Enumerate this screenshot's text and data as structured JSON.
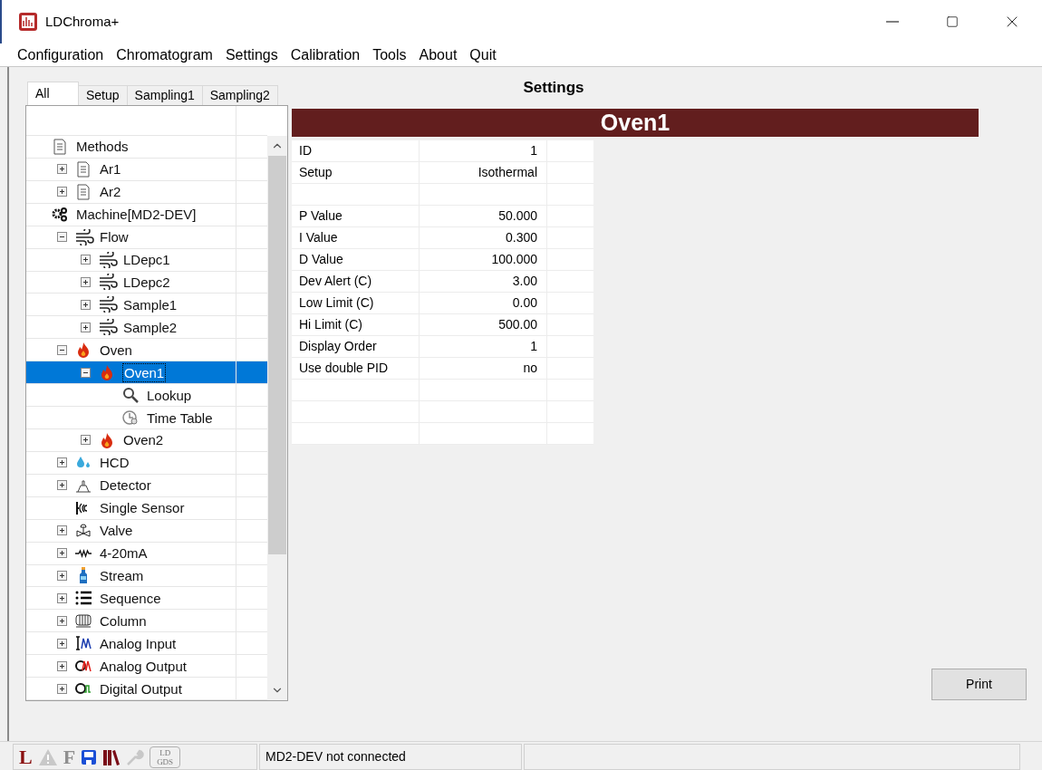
{
  "window": {
    "title": "LDChroma+"
  },
  "menu": [
    "Configuration",
    "Chromatogram",
    "Settings",
    "Calibration",
    "Tools",
    "About",
    "Quit"
  ],
  "tabs": [
    {
      "label": "All",
      "selected": true
    },
    {
      "label": "Setup",
      "selected": false
    },
    {
      "label": "Sampling1",
      "selected": false
    },
    {
      "label": "Sampling2",
      "selected": false
    }
  ],
  "tree": [
    {
      "label": "Methods",
      "kind": "document",
      "selected": false,
      "children": [
        {
          "label": "Ar1",
          "kind": "document",
          "expanded": false,
          "selected": false
        },
        {
          "label": "Ar2",
          "kind": "document",
          "expanded": false,
          "selected": false
        }
      ]
    },
    {
      "label": "Machine[MD2-DEV]",
      "kind": "gears",
      "selected": false,
      "children": [
        {
          "label": "Flow",
          "kind": "flow",
          "expanded": true,
          "selected": false,
          "children": [
            {
              "label": "LDepc1",
              "kind": "flow",
              "expanded": false,
              "selected": false
            },
            {
              "label": "LDepc2",
              "kind": "flow",
              "expanded": false,
              "selected": false
            },
            {
              "label": "Sample1",
              "kind": "flow",
              "expanded": false,
              "selected": false
            },
            {
              "label": "Sample2",
              "kind": "flow",
              "expanded": false,
              "selected": false
            }
          ]
        },
        {
          "label": "Oven",
          "kind": "flame",
          "expanded": true,
          "selected": false,
          "children": [
            {
              "label": "Oven1",
              "kind": "flame",
              "expanded": true,
              "selected": true,
              "children": [
                {
                  "label": "Lookup",
                  "kind": "search",
                  "selected": false
                },
                {
                  "label": "Time Table",
                  "kind": "clock",
                  "selected": false
                }
              ]
            },
            {
              "label": "Oven2",
              "kind": "flame",
              "expanded": false,
              "selected": false
            }
          ]
        },
        {
          "label": "HCD",
          "kind": "drops",
          "expanded": false,
          "selected": false
        },
        {
          "label": "Detector",
          "kind": "detector",
          "expanded": false,
          "selected": false
        },
        {
          "label": "Single Sensor",
          "kind": "sensor",
          "selected": false
        },
        {
          "label": "Valve",
          "kind": "valve",
          "expanded": false,
          "selected": false
        },
        {
          "label": "4-20mA",
          "kind": "resistor",
          "expanded": false,
          "selected": false
        },
        {
          "label": "Stream",
          "kind": "bottle",
          "expanded": false,
          "selected": false
        },
        {
          "label": "Sequence",
          "kind": "list",
          "expanded": false,
          "selected": false
        },
        {
          "label": "Column",
          "kind": "column",
          "expanded": false,
          "selected": false
        },
        {
          "label": "Analog Input",
          "kind": "analog-in",
          "expanded": false,
          "selected": false
        },
        {
          "label": "Analog Output",
          "kind": "analog-out",
          "expanded": false,
          "selected": false
        },
        {
          "label": "Digital Output",
          "kind": "digital-out",
          "expanded": false,
          "selected": false
        }
      ]
    }
  ],
  "settings": {
    "title": "Settings",
    "banner": "Oven1",
    "rows": [
      {
        "kind": "field",
        "label": "ID",
        "value": "1"
      },
      {
        "kind": "field",
        "label": "Setup",
        "value": "Isothermal"
      },
      {
        "kind": "blank"
      },
      {
        "kind": "field",
        "label": "P Value",
        "value": "50.000"
      },
      {
        "kind": "field",
        "label": "I Value",
        "value": "0.300"
      },
      {
        "kind": "field",
        "label": "D Value",
        "value": "100.000"
      },
      {
        "kind": "field",
        "label": "Dev Alert (C)",
        "value": "3.00"
      },
      {
        "kind": "field",
        "label": "Low Limit (C)",
        "value": "0.00"
      },
      {
        "kind": "field",
        "label": "Hi Limit (C)",
        "value": "500.00"
      },
      {
        "kind": "field",
        "label": "Display Order",
        "value": "1"
      },
      {
        "kind": "field",
        "label": "Use double PID",
        "value": "no"
      },
      {
        "kind": "blank"
      },
      {
        "kind": "blank"
      },
      {
        "kind": "blank"
      }
    ],
    "print_button": "Print"
  },
  "status_bar": {
    "icons": [
      {
        "kind": "letter",
        "label": "L",
        "disabled": false
      },
      {
        "kind": "warning",
        "disabled": true
      },
      {
        "kind": "letter",
        "label": "F",
        "disabled": true
      },
      {
        "kind": "save",
        "disabled": false
      },
      {
        "kind": "library",
        "disabled": false
      },
      {
        "kind": "wrench",
        "disabled": true
      },
      {
        "kind": "badge",
        "label": "LD GDS",
        "disabled": true
      }
    ],
    "message": "MD2-DEV not connected"
  }
}
